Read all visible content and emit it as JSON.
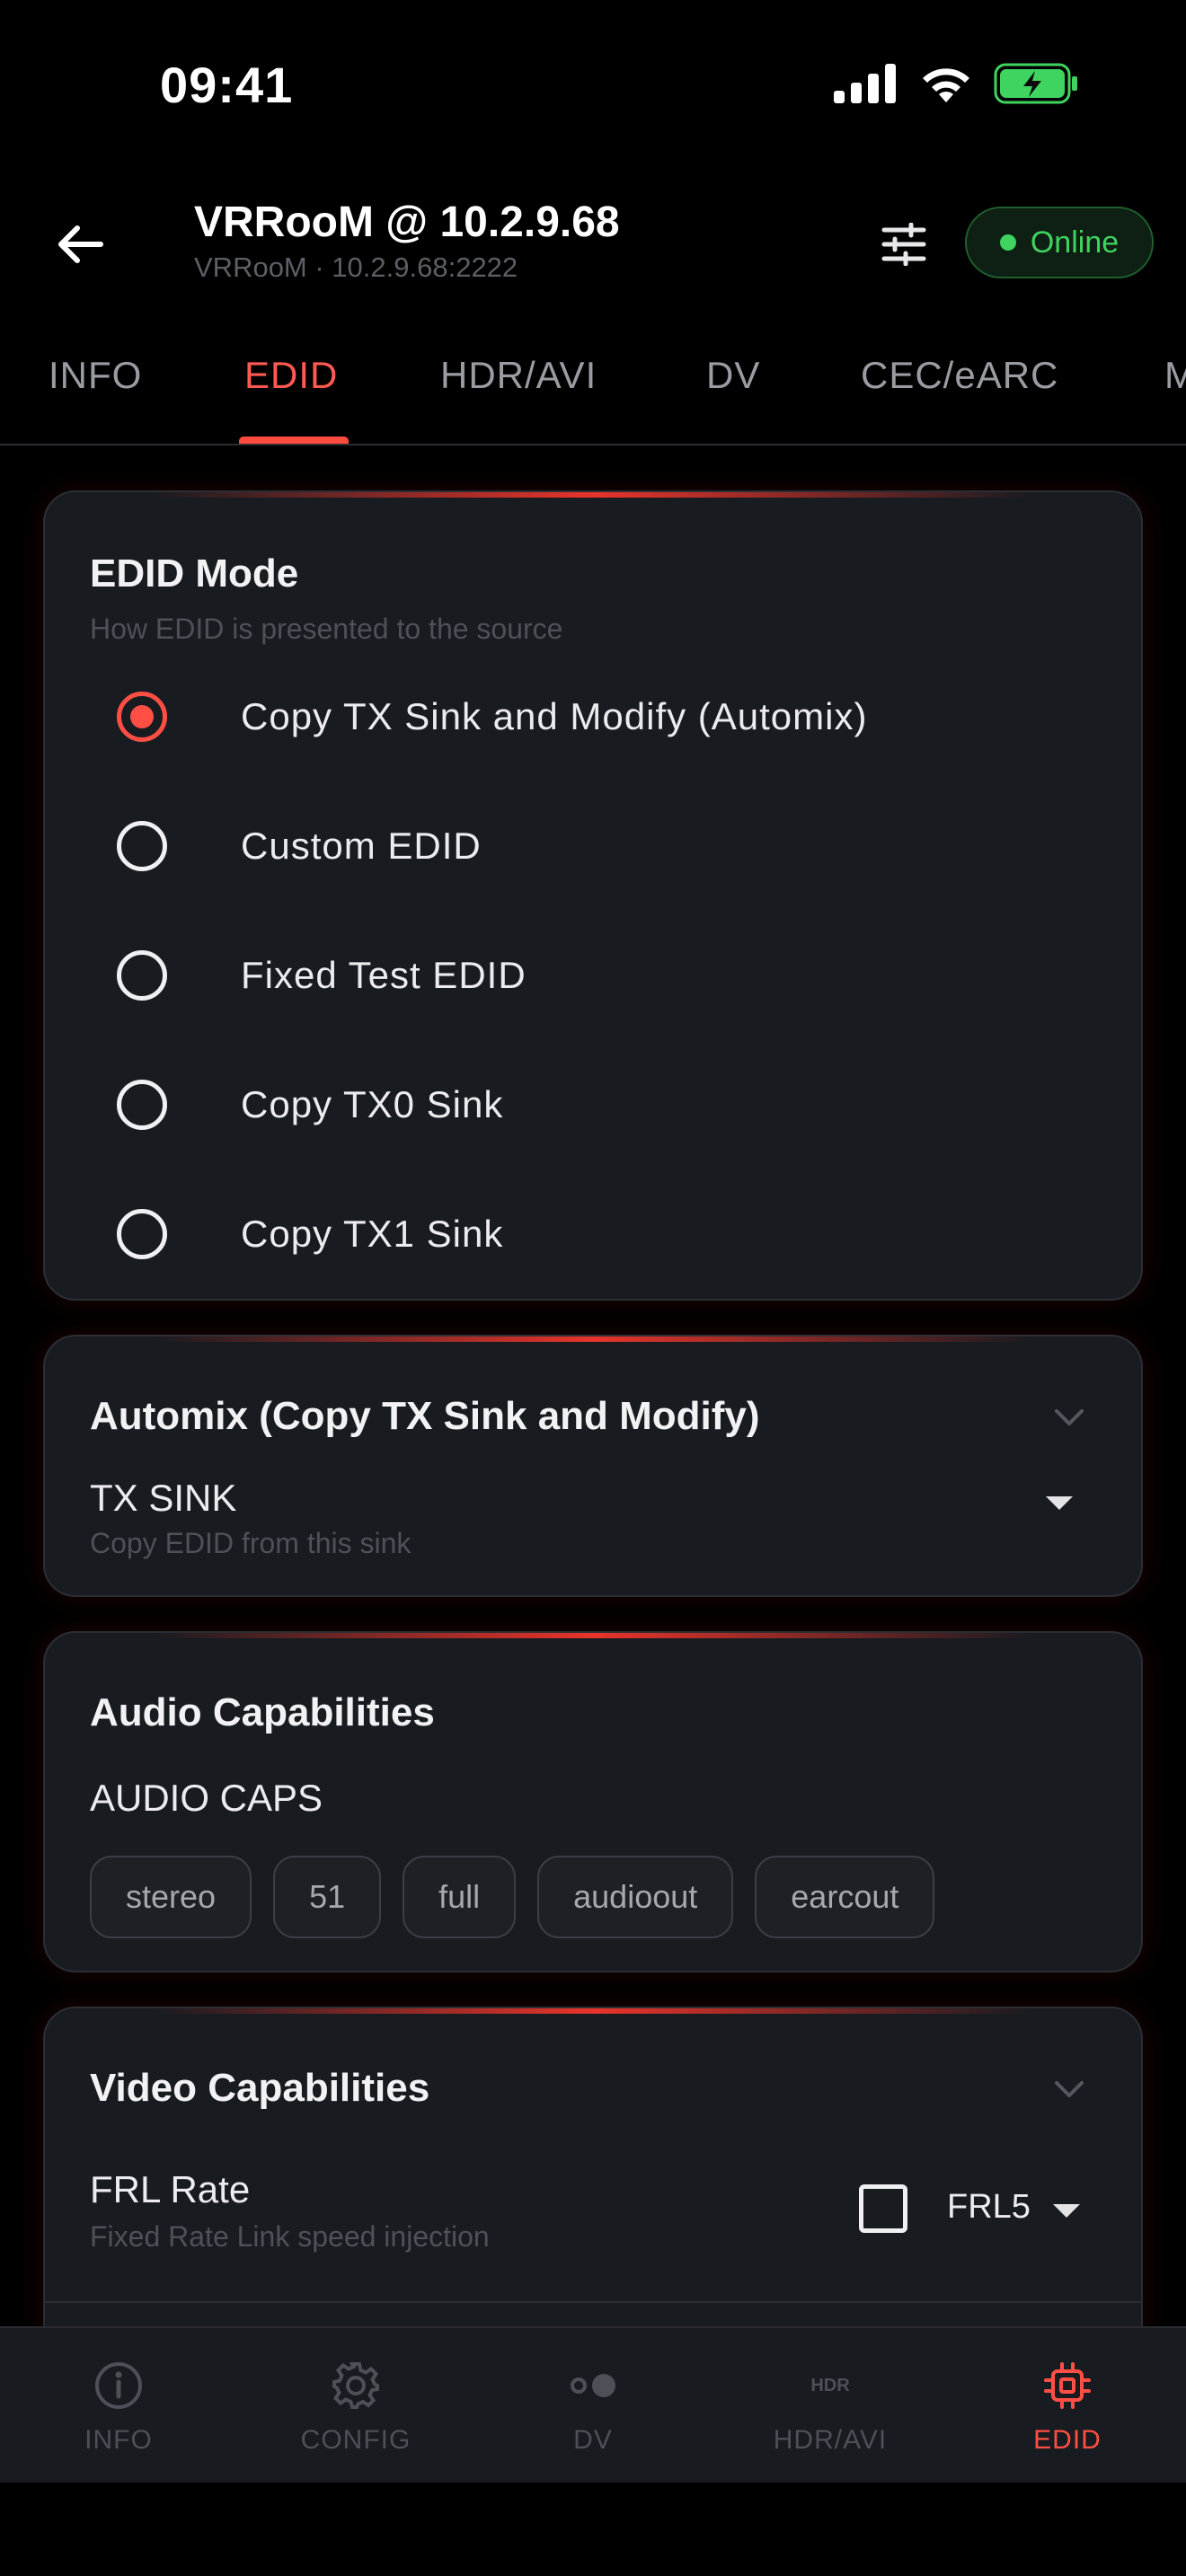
{
  "status_bar": {
    "time": "09:41"
  },
  "header": {
    "title": "VRRooM @ 10.2.9.68",
    "subtitle": "VRRooM  ·  10.2.9.68:2222",
    "status": "Online"
  },
  "tabs": [
    {
      "label": "INFO"
    },
    {
      "label": "EDID",
      "active": true
    },
    {
      "label": "HDR/AVI"
    },
    {
      "label": "DV"
    },
    {
      "label": "CEC/eARC"
    },
    {
      "label": "M"
    }
  ],
  "edid_mode": {
    "title": "EDID Mode",
    "subtitle": "How EDID is presented to the source",
    "options": [
      {
        "label": "Copy TX Sink and Modify (Automix)",
        "selected": true
      },
      {
        "label": "Custom EDID",
        "selected": false
      },
      {
        "label": "Fixed Test EDID",
        "selected": false
      },
      {
        "label": "Copy TX0 Sink",
        "selected": false
      },
      {
        "label": "Copy TX1 Sink",
        "selected": false
      }
    ]
  },
  "automix": {
    "title": "Automix (Copy TX Sink and Modify)",
    "tx_sink_label": "TX SINK",
    "tx_sink_help": "Copy EDID from this sink"
  },
  "audio": {
    "title": "Audio Capabilities",
    "caps_label": "AUDIO CAPS",
    "chips": [
      "stereo",
      "51",
      "full",
      "audioout",
      "earcout"
    ]
  },
  "video": {
    "title": "Video Capabilities",
    "frl_label": "FRL Rate",
    "frl_help": "Fixed Rate Link speed injection",
    "frl_value": "FRL5",
    "frl_enabled": false
  },
  "bottom_nav": [
    {
      "label": "INFO",
      "icon": "info-icon"
    },
    {
      "label": "CONFIG",
      "icon": "gear-icon"
    },
    {
      "label": "DV",
      "icon": "toggle-dots-icon"
    },
    {
      "label": "HDR/AVI",
      "icon": "hdr-icon",
      "icon_text": "HDR"
    },
    {
      "label": "EDID",
      "icon": "chip-icon",
      "active": true
    }
  ],
  "colors": {
    "accent": "#ff4f45",
    "online": "#3fd45f",
    "card_bg": "#181b20",
    "background": "#000000"
  }
}
